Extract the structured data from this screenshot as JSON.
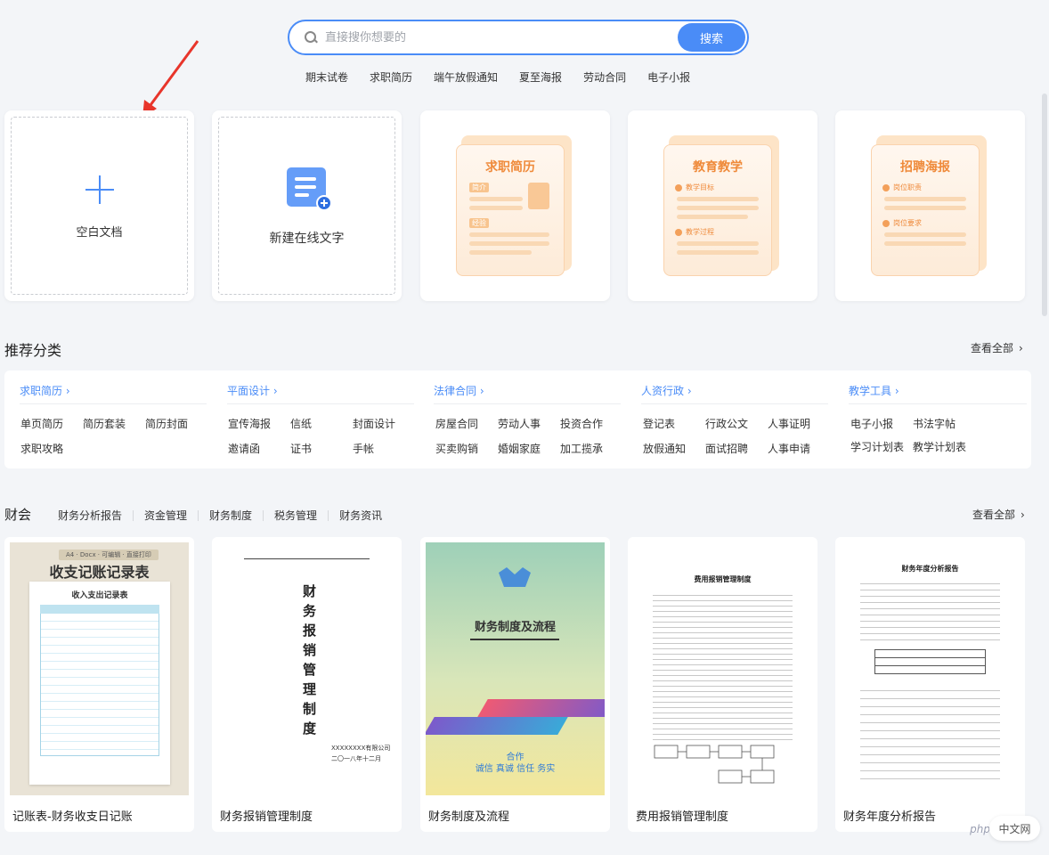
{
  "search": {
    "placeholder": "直接搜你想要的",
    "button_label": "搜索",
    "hot_tags": [
      "期末试卷",
      "求职简历",
      "端午放假通知",
      "夏至海报",
      "劳动合同",
      "电子小报"
    ]
  },
  "top_cards": {
    "blank_doc": "空白文档",
    "new_online": "新建在线文字",
    "templates": [
      {
        "title": "求职简历",
        "chips": [
          "简介",
          "经验"
        ]
      },
      {
        "title": "教育教学",
        "subs": [
          "教学目标",
          "教学过程"
        ]
      },
      {
        "title": "招聘海报",
        "subs": [
          "岗位职责",
          "岗位要求"
        ]
      }
    ]
  },
  "recommend": {
    "title": "推荐分类",
    "view_all": "查看全部",
    "columns": [
      {
        "head": "求职简历",
        "items": [
          "单页简历",
          "简历套装",
          "简历封面",
          "求职攻略"
        ]
      },
      {
        "head": "平面设计",
        "items": [
          "宣传海报",
          "信纸",
          "封面设计",
          "邀请函",
          "证书",
          "手帐"
        ]
      },
      {
        "head": "法律合同",
        "items": [
          "房屋合同",
          "劳动人事",
          "投资合作",
          "买卖购销",
          "婚姻家庭",
          "加工揽承"
        ]
      },
      {
        "head": "人资行政",
        "items": [
          "登记表",
          "行政公文",
          "人事证明",
          "放假通知",
          "面试招聘",
          "人事申请"
        ]
      },
      {
        "head": "教学工具",
        "items": [
          "电子小报",
          "书法字帖",
          "学习计划表",
          "教学计划表"
        ]
      }
    ]
  },
  "finance": {
    "title": "财会",
    "tabs": [
      "财务分析报告",
      "资金管理",
      "财务制度",
      "税务管理",
      "财务资讯"
    ],
    "view_all": "查看全部",
    "docs": [
      {
        "name": "记账表-财务收支日记账",
        "thumb_title": "收支记账记录表",
        "thumb_tag": "A4 · Docx · 可编辑 · 直接打印",
        "thumb_sub": "收入支出记录表"
      },
      {
        "name": "财务报销管理制度",
        "thumb_title": "财务报销管理制度",
        "thumb_company": "XXXXXXXX有限公司",
        "thumb_date": "二〇一八年十二月"
      },
      {
        "name": "财务制度及流程",
        "thumb_title": "财务制度及流程",
        "thumb_coop": "合作",
        "thumb_motto": "诚信 真诚 信任 务实"
      },
      {
        "name": "费用报销管理制度",
        "thumb_title": "费用报销管理制度"
      },
      {
        "name": "财务年度分析报告",
        "thumb_title": "财务年度分析报告"
      }
    ]
  },
  "badge": {
    "label": "中文网",
    "brand": "php"
  }
}
